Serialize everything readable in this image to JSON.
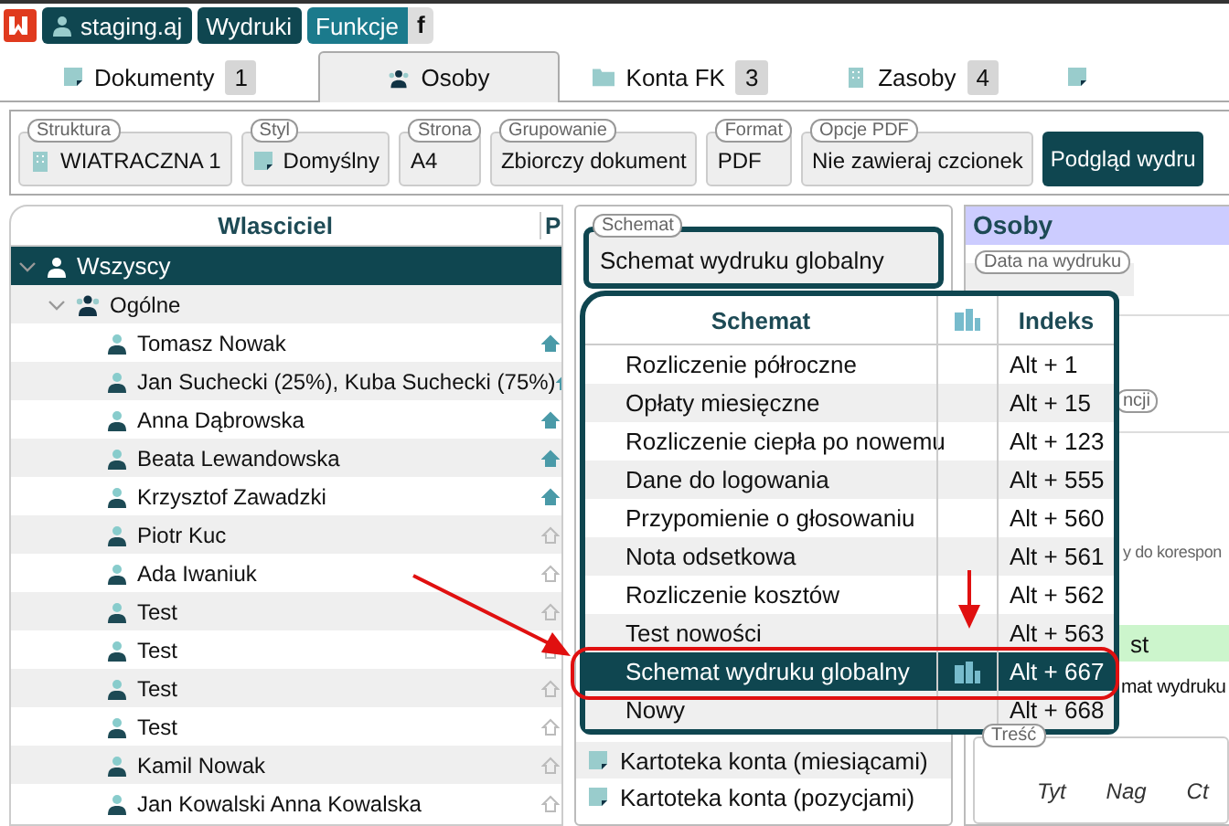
{
  "top_bar": {
    "user": "staging.aj",
    "buttons": [
      {
        "label": "Wydruki",
        "selected": false
      },
      {
        "label": "Funkcje",
        "selected": true
      }
    ],
    "shortcut": "f"
  },
  "tabs": [
    {
      "label": "Dokumenty",
      "count": "1",
      "selected": false
    },
    {
      "label": "Osoby",
      "selected": true
    },
    {
      "label": "Konta FK",
      "count": "3",
      "selected": false
    },
    {
      "label": "Zasoby",
      "count": "4",
      "selected": false
    },
    {
      "selected": false
    }
  ],
  "toolbar": {
    "fields": [
      {
        "label": "Struktura",
        "value": "WIATRACZNA 1"
      },
      {
        "label": "Styl",
        "value": "Domyślny"
      },
      {
        "label": "Strona",
        "value": "A4"
      },
      {
        "label": "Grupowanie",
        "value": "Zbiorczy dokument"
      },
      {
        "label": "Format",
        "value": "PDF"
      },
      {
        "label": "Opcje PDF",
        "value": "Nie zawieraj czcionek"
      }
    ],
    "preview_button": "Podgląd wydru"
  },
  "owners": {
    "columns": [
      "Wlasciciel",
      "P"
    ],
    "tree": [
      {
        "label": "Wszyscy",
        "kind": "person",
        "selected": true,
        "expanded": true,
        "children": [
          {
            "label": "Ogólne",
            "kind": "group",
            "selected": false,
            "expanded": true,
            "children": [
              {
                "label": "Tomasz Nowak",
                "kind": "person",
                "selected": false,
                "active": true
              },
              {
                "label": "Jan Suchecki (25%), Kuba Suchecki (75%)",
                "kind": "person",
                "selected": false,
                "active": true
              },
              {
                "label": "Anna Dąbrowska",
                "kind": "person",
                "selected": false,
                "active": true
              },
              {
                "label": "Beata Lewandowska",
                "kind": "person",
                "selected": false,
                "active": true
              },
              {
                "label": "Krzysztof Zawadzki",
                "kind": "person",
                "selected": false,
                "active": true
              },
              {
                "label": "Piotr Kuc",
                "kind": "person",
                "selected": false,
                "active": false
              },
              {
                "label": "Ada Iwaniuk",
                "kind": "person",
                "selected": false,
                "active": false
              },
              {
                "label": "Test",
                "kind": "person",
                "selected": false,
                "active": false
              },
              {
                "label": "Test",
                "kind": "person",
                "selected": false,
                "active": false
              },
              {
                "label": "Test",
                "kind": "person",
                "selected": false,
                "active": false
              },
              {
                "label": "Test",
                "kind": "person",
                "selected": false,
                "active": false
              },
              {
                "label": "Kamil Nowak",
                "kind": "person",
                "selected": false,
                "active": false
              },
              {
                "label": "Jan Kowalski Anna Kowalska",
                "kind": "person",
                "selected": false,
                "active": false
              }
            ]
          }
        ]
      }
    ]
  },
  "schema": {
    "label": "Schemat",
    "value": "Schemat wydruku globalny",
    "dropdown": {
      "columns": [
        "Schemat",
        "Indeks"
      ],
      "rows": [
        {
          "name": "Rozliczenie półroczne",
          "index": "Alt + 1",
          "global": false,
          "selected": false
        },
        {
          "name": "Opłaty miesięczne",
          "index": "Alt + 15",
          "global": false,
          "selected": false
        },
        {
          "name": "Rozliczenie ciepła po nowemu",
          "index": "Alt + 123",
          "global": false,
          "selected": false
        },
        {
          "name": "Dane do logowania",
          "index": "Alt + 555",
          "global": false,
          "selected": false
        },
        {
          "name": "Przypomienie o głosowaniu",
          "index": "Alt + 560",
          "global": false,
          "selected": false
        },
        {
          "name": "Nota odsetkowa",
          "index": "Alt + 561",
          "global": false,
          "selected": false
        },
        {
          "name": "Rozliczenie kosztów",
          "index": "Alt + 562",
          "global": false,
          "selected": false
        },
        {
          "name": "Test nowości",
          "index": "Alt + 563",
          "global": false,
          "selected": false
        },
        {
          "name": "Schemat wydruku globalny",
          "index": "Alt + 667",
          "global": true,
          "selected": true
        },
        {
          "name": "Nowy",
          "index": "Alt + 668",
          "global": false,
          "selected": false
        }
      ]
    },
    "list": [
      "Kartoteka konta (miesiącami)",
      "Kartoteka konta (pozycjami)"
    ]
  },
  "details": {
    "title": "Osoby",
    "date_label": "Data na wydruku",
    "label_2": "ncji",
    "label_3": "y do korespon",
    "highlight": "st",
    "text": "mat wydruku",
    "content_label": "Treść",
    "content_columns": [
      "Tyt",
      "Nag",
      "Ct"
    ]
  }
}
